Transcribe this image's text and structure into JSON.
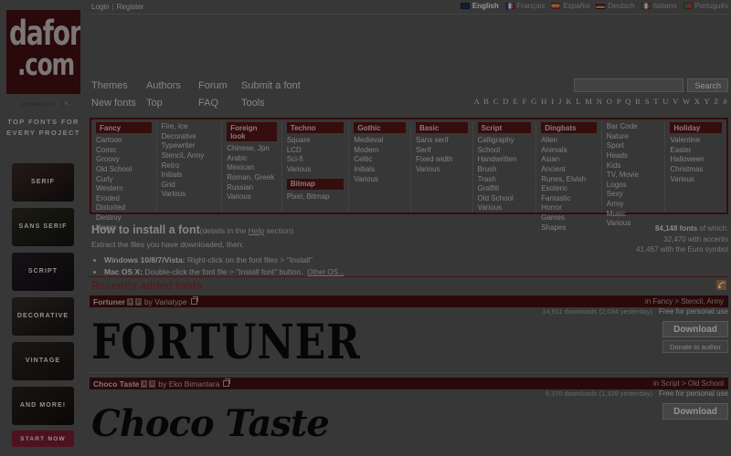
{
  "site": {
    "logo_line1": "dafont",
    "logo_line2": ".com"
  },
  "topbar": {
    "login": "Login",
    "separator": "|",
    "register": "Register",
    "languages": [
      {
        "label": "English",
        "active": true,
        "flag": "#16305e"
      },
      {
        "label": "Français",
        "active": false,
        "flag": "#d8d8d8"
      },
      {
        "label": "Español",
        "active": false,
        "flag": "#c8a02a"
      },
      {
        "label": "Deutsch",
        "active": false,
        "flag": "#b08a2a"
      },
      {
        "label": "Italiano",
        "active": false,
        "flag": "#2f7a3a"
      },
      {
        "label": "Português",
        "active": false,
        "flag": "#2f7a3a"
      }
    ]
  },
  "nav": {
    "row1": [
      "Themes",
      "Authors",
      "Forum",
      "Submit a font"
    ],
    "row2": [
      "New fonts",
      "Top",
      "FAQ",
      "Tools"
    ]
  },
  "search": {
    "value": "",
    "placeholder": "",
    "button": "Search"
  },
  "alphabet": "A B C D E F G H I J K L M N O P Q R S T U V W X Y Z #",
  "categories": [
    {
      "heading": "Fancy",
      "items": [
        "Cartoon",
        "Comic",
        "Groovy",
        "Old School",
        "Curly",
        "Western",
        "Eroded",
        "Distorted",
        "Destroy",
        "Horror"
      ]
    },
    {
      "heading": "",
      "items": [
        "Fire, Ice",
        "Decorative",
        "Typewriter",
        "Stencil, Army",
        "Retro",
        "Initials",
        "Grid",
        "Various"
      ]
    },
    {
      "heading": "Foreign look",
      "items": [
        "Chinese, Jpn",
        "Arabic",
        "Mexican",
        "Roman, Greek",
        "Russian",
        "Various"
      ]
    },
    {
      "heading": "Techno",
      "items": [
        "Square",
        "LCD",
        "Sci-fi",
        "Various"
      ],
      "heading2": "Bitmap",
      "items2": [
        "Pixel, Bitmap"
      ]
    },
    {
      "heading": "Gothic",
      "items": [
        "Medieval",
        "Modern",
        "Celtic",
        "Initials",
        "Various"
      ]
    },
    {
      "heading": "Basic",
      "items": [
        "Sans serif",
        "Serif",
        "Fixed width",
        "Various"
      ]
    },
    {
      "heading": "Script",
      "items": [
        "Calligraphy",
        "School",
        "Handwritten",
        "Brush",
        "Trash",
        "Graffiti",
        "Old School",
        "Various"
      ]
    },
    {
      "heading": "Dingbats",
      "items": [
        "Alien",
        "Animals",
        "Asian",
        "Ancient",
        "Runes, Elvish",
        "Esoteric",
        "Fantastic",
        "Horror",
        "Games",
        "Shapes"
      ]
    },
    {
      "heading": "",
      "items": [
        "Bar Code",
        "Nature",
        "Sport",
        "Heads",
        "Kids",
        "TV, Movie",
        "Logos",
        "Sexy",
        "Army",
        "Music",
        "Various"
      ]
    },
    {
      "heading": "Holiday",
      "items": [
        "Valentine",
        "Easter",
        "Halloween",
        "Christmas",
        "Various"
      ]
    }
  ],
  "install": {
    "title": "How to install a font",
    "details_pre": "(details in the ",
    "details_link": "Help",
    "details_post": " section)",
    "extract": "Extract the files you have downloaded, then:",
    "bullets": [
      {
        "os": "Windows 10/8/7/Vista:",
        "text": " Right-click on the font files > \"Install\"",
        "link": ""
      },
      {
        "os": "Mac OS X:",
        "text": " Double-click the font file > \"Install font\" button.",
        "link": "Other OS..."
      }
    ]
  },
  "stats": {
    "total_bold": "84,148 fonts",
    "total_rest": " of which:",
    "accents": "32,470 with accents",
    "euro": "41,467 with the Euro symbol"
  },
  "recent": {
    "title": "Recently added fonts",
    "rss_icon": "rss-icon"
  },
  "fonts": [
    {
      "name": "Fortuner",
      "badges": [
        "a",
        "b"
      ],
      "by": "by Variatype",
      "category": "in Fancy > Stencil, Army",
      "downloads": "14,611 downloads (2,034 yesterday)",
      "license": "Free for personal use",
      "preview": "FORTUNER",
      "download_label": "Download",
      "donate_label": "Donate to author"
    },
    {
      "name": "Choco Taste",
      "badges": [
        "a",
        "b"
      ],
      "by": "by Eko Bimantara",
      "category": "in Script > Old School",
      "downloads": "9,370 downloads (1,328 yesterday)",
      "license": "Free for personal use",
      "preview": "Choco Taste",
      "download_label": "Download",
      "donate_label": ""
    }
  ],
  "ad": {
    "brand": "envato",
    "brand2": "elements",
    "title": "TOP FONTS FOR EVERY PROJECT",
    "cards": [
      "SERIF",
      "SANS SERIF",
      "SCRIPT",
      "DECORATIVE",
      "VINTAGE",
      "AND MORE!"
    ],
    "cta": "START NOW"
  },
  "colors": {
    "brand_red": "#4a0d0d",
    "accent_red": "#5e1212",
    "page_bg": "#595959"
  }
}
